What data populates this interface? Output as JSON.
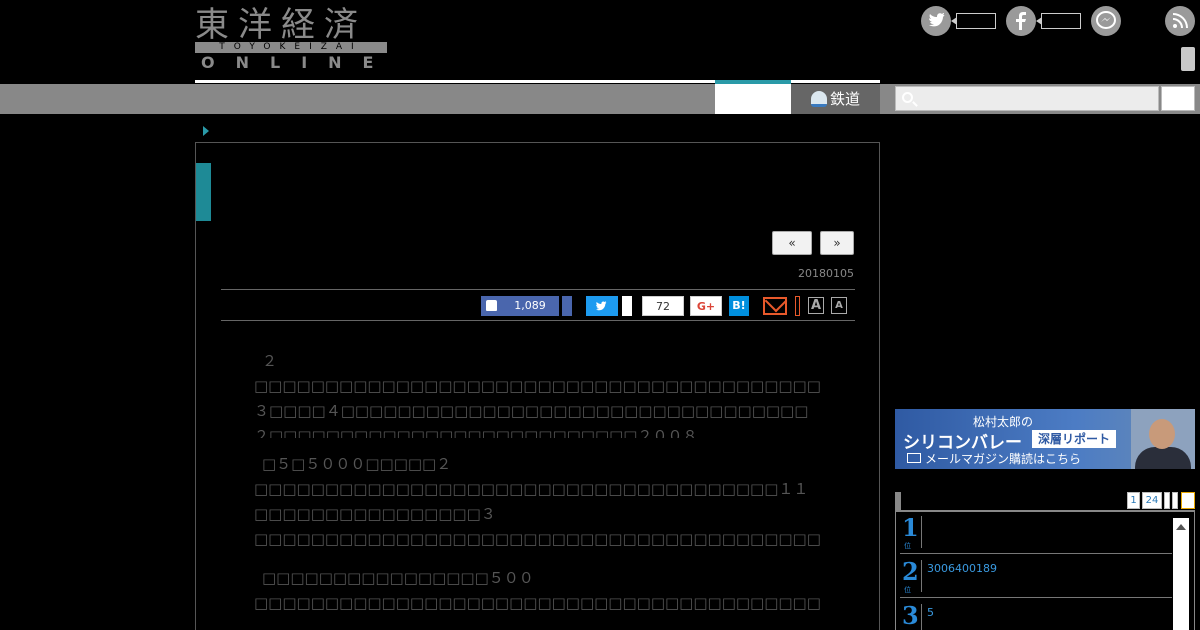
{
  "header": {
    "logo_kanji": "東洋経済",
    "logo_roman": "TOYOKEIZAI",
    "logo_online": "ONLINE"
  },
  "nav": {
    "railway_label": "鉄道"
  },
  "article": {
    "pager_prev": "«",
    "pager_next": "»",
    "date": "20180105",
    "share": {
      "like_count": "1,089",
      "pocket_count": "72",
      "gplus_label": "G+",
      "hatena_label": "B!",
      "font_large": "A",
      "font_small": "A"
    },
    "paragraphs": [
      "２□□□□□□□□□□□□□□□□□□□□□□□□□□□□□□□□□□□□□□□□□□□□□□□□□□□□□□□□□□□□□□□□□□□□□□□□□□□□□□□□□□□□□□□□□□□□□□３□□□□４□□□□□□□□□□□□□□□□□□□□□□□□□□□□□□□□□２□□□□□□□□□□□□□□□□□□□□□□□□□□２００８□□□□□□□□□□８６□□□□□□□□□□□□□□□□□□□□□□",
      "□５□５０００□□□□□２□□□□□□□□□□□□□□□□□□□□□□□□□□□□□□□□□□□□□１１□□□□□□□□□□□□□□□□３□□□□□□□□□□□□□□□□□□□□□□□□□□□□□□□□□□□□□□□□□□□□□□□□□□□□□□□□□□□□□□□□□□□□□□□□□□□□□□□□□□□□□□□□□□□□□□□□□□□□□□□□□□□□□□□□□□□□□□□□□□□□□□□□□□□□□□□□□□□□□□□",
      "□□□□□□□□□□□□□□□□５００□□□□□□□□□□□□□□□□□□□□□□□□□□□□□□□□□□□□□□□□□□□□□□□□□□□□□□□□□□□□□□□□□□□□□□□□□□□□□□□□□"
    ]
  },
  "sidebar": {
    "banner": {
      "author": "松村太郎の",
      "title": "シリコンバレー",
      "badge": "深層リポート",
      "subtitle": "メールマガジン購読はこちら"
    },
    "ranking": {
      "nav": [
        "1",
        "24"
      ],
      "items": [
        {
          "rank": "1",
          "suffix": "位",
          "text": ""
        },
        {
          "rank": "2",
          "suffix": "位",
          "text": "3006400189"
        },
        {
          "rank": "3",
          "suffix": "位",
          "text": "5"
        }
      ]
    }
  }
}
